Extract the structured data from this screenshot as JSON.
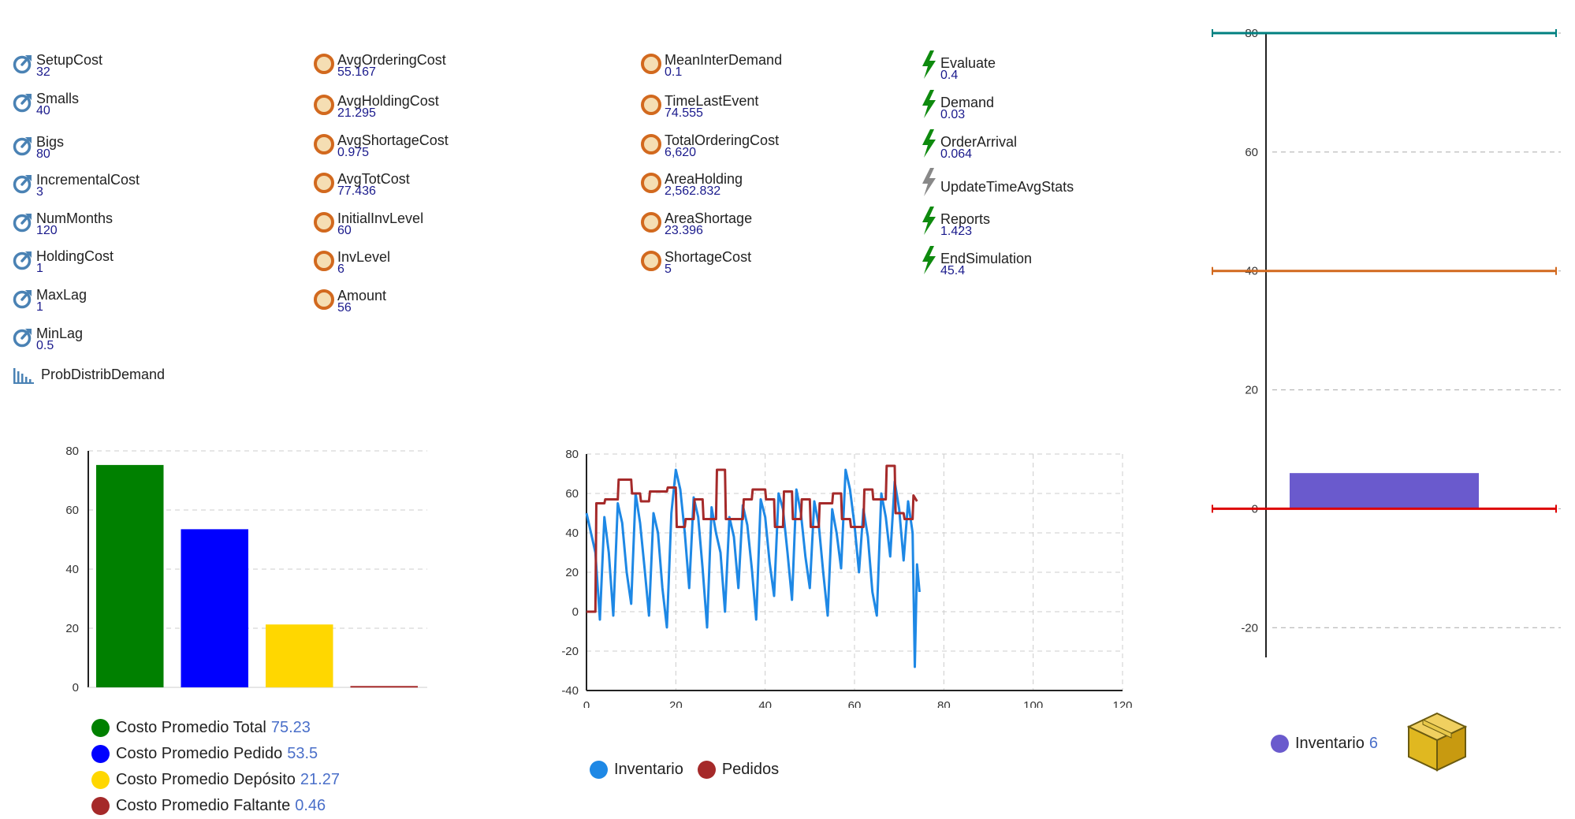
{
  "colors": {
    "param_icon": "#4a82b4",
    "var_icon": "#d2691e",
    "event_icon_active": "#0e8a0e",
    "event_icon_inactive": "#888888",
    "value_text": "#1a1a8c"
  },
  "parameters": [
    {
      "name": "SetupCost",
      "value": "32",
      "icon": "parameter-icon"
    },
    {
      "name": "Smalls",
      "value": "40",
      "icon": "parameter-icon"
    },
    {
      "name": "Bigs",
      "value": "80",
      "icon": "parameter-icon"
    },
    {
      "name": "IncrementalCost",
      "value": "3",
      "icon": "parameter-icon"
    },
    {
      "name": "NumMonths",
      "value": "120",
      "icon": "parameter-icon"
    },
    {
      "name": "HoldingCost",
      "value": "1",
      "icon": "parameter-icon"
    },
    {
      "name": "MaxLag",
      "value": "1",
      "icon": "parameter-icon"
    },
    {
      "name": "MinLag",
      "value": "0.5",
      "icon": "parameter-icon"
    }
  ],
  "distribution": {
    "name": "ProbDistribDemand",
    "icon": "histogram-icon"
  },
  "variables_a": [
    {
      "name": "AvgOrderingCost",
      "value": "55.167"
    },
    {
      "name": "AvgHoldingCost",
      "value": "21.295"
    },
    {
      "name": "AvgShortageCost",
      "value": "0.975"
    },
    {
      "name": "AvgTotCost",
      "value": "77.436"
    },
    {
      "name": "InitialInvLevel",
      "value": "60"
    },
    {
      "name": "InvLevel",
      "value": "6"
    },
    {
      "name": "Amount",
      "value": "56"
    }
  ],
  "variables_b": [
    {
      "name": "MeanInterDemand",
      "value": "0.1"
    },
    {
      "name": "TimeLastEvent",
      "value": "74.555"
    },
    {
      "name": "TotalOrderingCost",
      "value": "6,620"
    },
    {
      "name": "AreaHolding",
      "value": "2,562.832"
    },
    {
      "name": "AreaShortage",
      "value": "23.396"
    },
    {
      "name": "ShortageCost",
      "value": "5"
    }
  ],
  "events": [
    {
      "name": "Evaluate",
      "value": "0.4",
      "active": true
    },
    {
      "name": "Demand",
      "value": "0.03",
      "active": true
    },
    {
      "name": "OrderArrival",
      "value": "0.064",
      "active": true
    },
    {
      "name": "UpdateTimeAvgStats",
      "value": "",
      "active": false
    },
    {
      "name": "Reports",
      "value": "1.423",
      "active": true
    },
    {
      "name": "EndSimulation",
      "value": "45.4",
      "active": true
    }
  ],
  "chart_data": [
    {
      "type": "bar",
      "categories": [
        "Costo Promedio Total",
        "Costo Promedio Pedido",
        "Costo Promedio Depósito",
        "Costo Promedio Faltante"
      ],
      "values": [
        75.23,
        53.5,
        21.27,
        0.46
      ],
      "value_labels": [
        "75.23",
        "53.5",
        "21.27",
        "0.46"
      ],
      "colors": [
        "#008000",
        "#0000ff",
        "#ffd700",
        "#a52a2a"
      ],
      "ylim": [
        0,
        80
      ],
      "yticks": [
        "0",
        "20",
        "40",
        "60",
        "80"
      ],
      "grid": true,
      "legend": "bottom-left"
    },
    {
      "type": "line",
      "xlim": [
        0,
        120
      ],
      "ylim": [
        -40,
        80
      ],
      "xticks": [
        "0",
        "20",
        "40",
        "60",
        "80",
        "100",
        "120"
      ],
      "yticks": [
        "-40",
        "-20",
        "0",
        "20",
        "40",
        "60",
        "80"
      ],
      "grid": true,
      "legend": "bottom-left",
      "series": [
        {
          "name": "Inventario",
          "color": "#1e88e5",
          "points": [
            [
              0,
              50
            ],
            [
              1,
              40
            ],
            [
              2,
              30
            ],
            [
              3,
              -4
            ],
            [
              4,
              48
            ],
            [
              5,
              30
            ],
            [
              6,
              -2
            ],
            [
              7,
              55
            ],
            [
              8,
              45
            ],
            [
              9,
              20
            ],
            [
              10,
              4
            ],
            [
              11,
              60
            ],
            [
              12,
              45
            ],
            [
              13,
              22
            ],
            [
              14,
              -2
            ],
            [
              15,
              50
            ],
            [
              16,
              40
            ],
            [
              17,
              12
            ],
            [
              18,
              -8
            ],
            [
              19,
              50
            ],
            [
              20,
              72
            ],
            [
              21,
              62
            ],
            [
              22,
              40
            ],
            [
              23,
              12
            ],
            [
              24,
              58
            ],
            [
              25,
              48
            ],
            [
              26,
              22
            ],
            [
              27,
              -8
            ],
            [
              28,
              53
            ],
            [
              29,
              40
            ],
            [
              30,
              30
            ],
            [
              31,
              0
            ],
            [
              32,
              48
            ],
            [
              33,
              38
            ],
            [
              34,
              12
            ],
            [
              35,
              54
            ],
            [
              36,
              44
            ],
            [
              37,
              22
            ],
            [
              38,
              -4
            ],
            [
              39,
              57
            ],
            [
              40,
              48
            ],
            [
              41,
              25
            ],
            [
              42,
              8
            ],
            [
              43,
              60
            ],
            [
              44,
              52
            ],
            [
              45,
              30
            ],
            [
              46,
              6
            ],
            [
              47,
              62
            ],
            [
              48,
              50
            ],
            [
              49,
              28
            ],
            [
              50,
              12
            ],
            [
              51,
              56
            ],
            [
              52,
              44
            ],
            [
              53,
              20
            ],
            [
              54,
              -2
            ],
            [
              55,
              52
            ],
            [
              56,
              40
            ],
            [
              57,
              22
            ],
            [
              58,
              72
            ],
            [
              59,
              62
            ],
            [
              60,
              44
            ],
            [
              61,
              20
            ],
            [
              62,
              52
            ],
            [
              63,
              38
            ],
            [
              64,
              10
            ],
            [
              65,
              -2
            ],
            [
              66,
              60
            ],
            [
              67,
              48
            ],
            [
              68,
              28
            ],
            [
              69,
              66
            ],
            [
              70,
              52
            ],
            [
              71,
              26
            ],
            [
              72,
              56
            ],
            [
              73,
              40
            ],
            [
              73.5,
              -28
            ],
            [
              74,
              24
            ],
            [
              74.555,
              10
            ]
          ]
        },
        {
          "name": "Pedidos",
          "color": "#a52a2a",
          "points": [
            [
              0,
              0
            ],
            [
              2,
              0
            ],
            [
              2.2,
              55
            ],
            [
              4,
              55
            ],
            [
              4.2,
              57
            ],
            [
              7,
              57
            ],
            [
              7.2,
              67
            ],
            [
              10,
              67
            ],
            [
              10.2,
              60
            ],
            [
              12,
              60
            ],
            [
              12.2,
              56
            ],
            [
              14,
              56
            ],
            [
              14.2,
              61
            ],
            [
              18,
              61
            ],
            [
              18.2,
              63
            ],
            [
              20,
              63
            ],
            [
              20.2,
              43
            ],
            [
              22,
              43
            ],
            [
              22.2,
              47
            ],
            [
              24,
              47
            ],
            [
              24.2,
              57
            ],
            [
              26,
              57
            ],
            [
              26.2,
              47
            ],
            [
              29,
              47
            ],
            [
              29.2,
              72
            ],
            [
              31,
              72
            ],
            [
              31.2,
              47
            ],
            [
              35,
              47
            ],
            [
              35.2,
              57
            ],
            [
              37,
              57
            ],
            [
              37.2,
              62
            ],
            [
              40,
              62
            ],
            [
              40.2,
              57
            ],
            [
              42,
              57
            ],
            [
              42.2,
              43
            ],
            [
              44,
              43
            ],
            [
              44.2,
              61
            ],
            [
              46,
              61
            ],
            [
              46.2,
              47
            ],
            [
              48,
              47
            ],
            [
              48.2,
              57
            ],
            [
              50,
              57
            ],
            [
              50.2,
              43
            ],
            [
              52,
              43
            ],
            [
              52.2,
              55
            ],
            [
              55,
              55
            ],
            [
              55.2,
              60
            ],
            [
              57,
              60
            ],
            [
              57.2,
              47
            ],
            [
              59,
              47
            ],
            [
              59.2,
              43
            ],
            [
              62,
              43
            ],
            [
              62.2,
              62
            ],
            [
              64,
              62
            ],
            [
              64.2,
              57
            ],
            [
              67,
              57
            ],
            [
              67.2,
              74
            ],
            [
              69,
              74
            ],
            [
              69.2,
              50
            ],
            [
              71,
              50
            ],
            [
              71.2,
              47
            ],
            [
              73,
              47
            ],
            [
              73.2,
              59
            ],
            [
              74,
              56
            ]
          ]
        }
      ]
    },
    {
      "type": "bar",
      "categories": [
        "Inventario"
      ],
      "values": [
        6
      ],
      "value_labels": [
        "6"
      ],
      "colors": [
        "#6a5acd"
      ],
      "ylim": [
        -25,
        80
      ],
      "yticks": [
        "-20",
        "0",
        "20",
        "40",
        "60",
        "80"
      ],
      "grid": true,
      "legend": "bottom",
      "reference_lines": [
        {
          "y": 80,
          "color": "#008080"
        },
        {
          "y": 40,
          "color": "#d2691e"
        },
        {
          "y": 0,
          "color": "#dd0000"
        }
      ]
    }
  ]
}
